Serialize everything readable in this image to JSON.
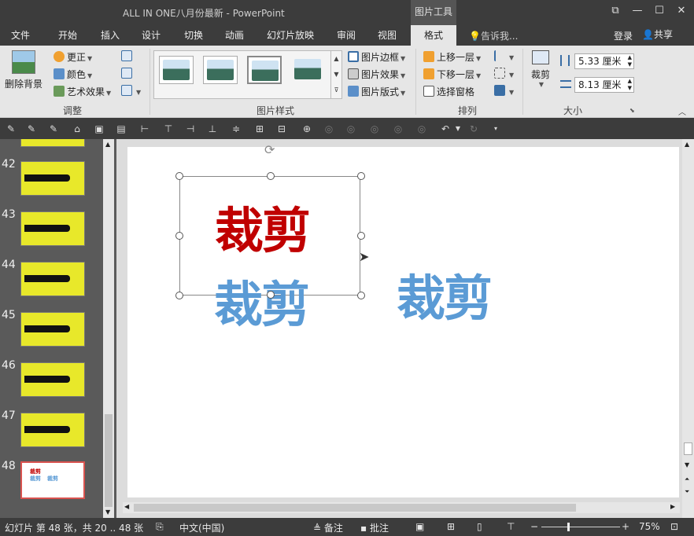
{
  "window": {
    "title": "ALL IN ONE八月份最新 - PowerPoint",
    "context_tab": "图片工具",
    "buttons": {
      "restore": "⧉",
      "minimize": "—",
      "maximize": "☐",
      "close": "✕"
    }
  },
  "tabs": [
    {
      "label": "文件"
    },
    {
      "label": "开始"
    },
    {
      "label": "插入"
    },
    {
      "label": "设计"
    },
    {
      "label": "切换"
    },
    {
      "label": "动画"
    },
    {
      "label": "幻灯片放映"
    },
    {
      "label": "审阅"
    },
    {
      "label": "视图"
    },
    {
      "label": "格式"
    }
  ],
  "tell_me": "告诉我...",
  "login": "登录",
  "share": "共享",
  "ribbon": {
    "adjust": {
      "remove_bg": "删除背景",
      "corrections": "更正",
      "color": "颜色",
      "artistic": "艺术效果",
      "label": "调整"
    },
    "styles": {
      "label": "图片样式",
      "border": "图片边框",
      "effects": "图片效果",
      "layout": "图片版式"
    },
    "arrange": {
      "label": "排列",
      "bring_forward": "上移一层",
      "send_backward": "下移一层",
      "selection_pane": "选择窗格"
    },
    "size": {
      "label": "大小",
      "crop": "裁剪",
      "height": "5.33 厘米",
      "width": "8.13 厘米"
    }
  },
  "slides": [
    {
      "number": "42"
    },
    {
      "number": "43"
    },
    {
      "number": "44"
    },
    {
      "number": "45"
    },
    {
      "number": "46"
    },
    {
      "number": "47"
    },
    {
      "number": "48"
    }
  ],
  "slide_content": {
    "red_text": "裁剪",
    "blue_text_1": "裁剪",
    "blue_text_2": "裁剪",
    "colors": {
      "red": "#c00000",
      "blue": "#5b9bd5"
    }
  },
  "status": {
    "slide_info": "幻灯片 第 48 张，共 20 .. 48 张",
    "language": "中文(中国)",
    "notes": "备注",
    "comments": "批注",
    "zoom": "75%"
  }
}
